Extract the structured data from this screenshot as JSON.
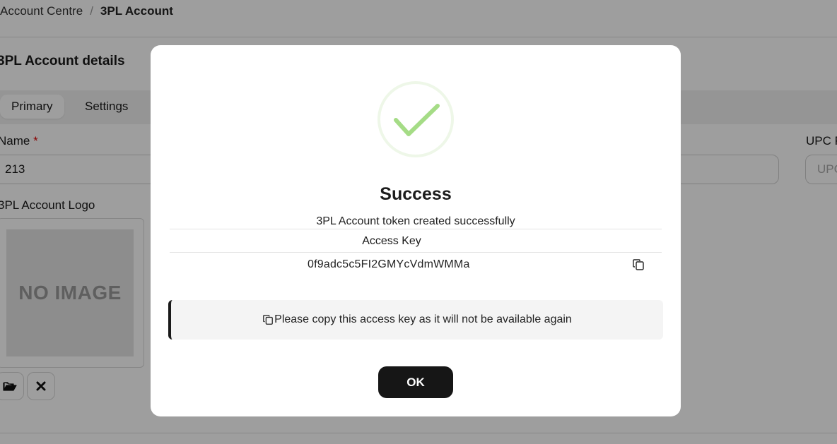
{
  "breadcrumb": {
    "parent": "Account Centre",
    "separator": "/",
    "current": "3PL Account"
  },
  "page": {
    "title": "3PL Account details",
    "tabs": [
      {
        "label": "Primary",
        "active": true
      },
      {
        "label": "Settings",
        "active": false
      }
    ],
    "name_field": {
      "label": "Name",
      "required_mark": "*",
      "value": "213"
    },
    "upc_field": {
      "label": "UPC P",
      "placeholder": "UPC"
    },
    "logo": {
      "label": "3PL Account Logo",
      "placeholder_text": "NO IMAGE"
    },
    "buttons": {
      "open_icon": "folder-open-icon",
      "remove_icon": "close-icon"
    }
  },
  "modal": {
    "icon": "success-checkmark-icon",
    "title": "Success",
    "message": "3PL Account token created successfully",
    "key_header": "Access Key",
    "access_key": "0f9adc5c5FI2GMYcVdmWMMa",
    "copy_icon": "copy-icon",
    "notice": "Please copy this access key as it will not be available again",
    "ok_label": "OK"
  },
  "colors": {
    "accent_success": "#a5dc86",
    "success_ring": "#eef7e8",
    "primary_button": "#161616",
    "overlay": "rgba(0,0,0,0.38)"
  }
}
